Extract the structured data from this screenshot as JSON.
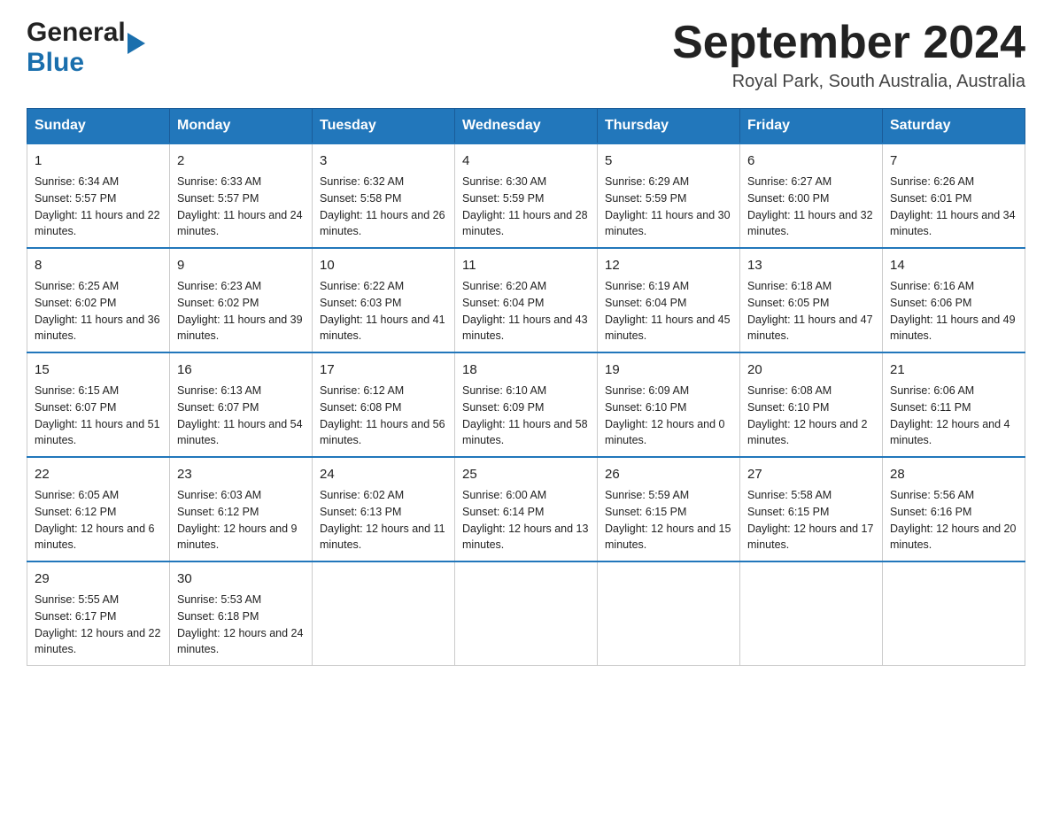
{
  "logo": {
    "general": "General",
    "triangle": "▶",
    "blue": "Blue"
  },
  "title": "September 2024",
  "subtitle": "Royal Park, South Australia, Australia",
  "days_header": [
    "Sunday",
    "Monday",
    "Tuesday",
    "Wednesday",
    "Thursday",
    "Friday",
    "Saturday"
  ],
  "weeks": [
    [
      {
        "day": "1",
        "sunrise": "6:34 AM",
        "sunset": "5:57 PM",
        "daylight": "11 hours and 22 minutes."
      },
      {
        "day": "2",
        "sunrise": "6:33 AM",
        "sunset": "5:57 PM",
        "daylight": "11 hours and 24 minutes."
      },
      {
        "day": "3",
        "sunrise": "6:32 AM",
        "sunset": "5:58 PM",
        "daylight": "11 hours and 26 minutes."
      },
      {
        "day": "4",
        "sunrise": "6:30 AM",
        "sunset": "5:59 PM",
        "daylight": "11 hours and 28 minutes."
      },
      {
        "day": "5",
        "sunrise": "6:29 AM",
        "sunset": "5:59 PM",
        "daylight": "11 hours and 30 minutes."
      },
      {
        "day": "6",
        "sunrise": "6:27 AM",
        "sunset": "6:00 PM",
        "daylight": "11 hours and 32 minutes."
      },
      {
        "day": "7",
        "sunrise": "6:26 AM",
        "sunset": "6:01 PM",
        "daylight": "11 hours and 34 minutes."
      }
    ],
    [
      {
        "day": "8",
        "sunrise": "6:25 AM",
        "sunset": "6:02 PM",
        "daylight": "11 hours and 36 minutes."
      },
      {
        "day": "9",
        "sunrise": "6:23 AM",
        "sunset": "6:02 PM",
        "daylight": "11 hours and 39 minutes."
      },
      {
        "day": "10",
        "sunrise": "6:22 AM",
        "sunset": "6:03 PM",
        "daylight": "11 hours and 41 minutes."
      },
      {
        "day": "11",
        "sunrise": "6:20 AM",
        "sunset": "6:04 PM",
        "daylight": "11 hours and 43 minutes."
      },
      {
        "day": "12",
        "sunrise": "6:19 AM",
        "sunset": "6:04 PM",
        "daylight": "11 hours and 45 minutes."
      },
      {
        "day": "13",
        "sunrise": "6:18 AM",
        "sunset": "6:05 PM",
        "daylight": "11 hours and 47 minutes."
      },
      {
        "day": "14",
        "sunrise": "6:16 AM",
        "sunset": "6:06 PM",
        "daylight": "11 hours and 49 minutes."
      }
    ],
    [
      {
        "day": "15",
        "sunrise": "6:15 AM",
        "sunset": "6:07 PM",
        "daylight": "11 hours and 51 minutes."
      },
      {
        "day": "16",
        "sunrise": "6:13 AM",
        "sunset": "6:07 PM",
        "daylight": "11 hours and 54 minutes."
      },
      {
        "day": "17",
        "sunrise": "6:12 AM",
        "sunset": "6:08 PM",
        "daylight": "11 hours and 56 minutes."
      },
      {
        "day": "18",
        "sunrise": "6:10 AM",
        "sunset": "6:09 PM",
        "daylight": "11 hours and 58 minutes."
      },
      {
        "day": "19",
        "sunrise": "6:09 AM",
        "sunset": "6:10 PM",
        "daylight": "12 hours and 0 minutes."
      },
      {
        "day": "20",
        "sunrise": "6:08 AM",
        "sunset": "6:10 PM",
        "daylight": "12 hours and 2 minutes."
      },
      {
        "day": "21",
        "sunrise": "6:06 AM",
        "sunset": "6:11 PM",
        "daylight": "12 hours and 4 minutes."
      }
    ],
    [
      {
        "day": "22",
        "sunrise": "6:05 AM",
        "sunset": "6:12 PM",
        "daylight": "12 hours and 6 minutes."
      },
      {
        "day": "23",
        "sunrise": "6:03 AM",
        "sunset": "6:12 PM",
        "daylight": "12 hours and 9 minutes."
      },
      {
        "day": "24",
        "sunrise": "6:02 AM",
        "sunset": "6:13 PM",
        "daylight": "12 hours and 11 minutes."
      },
      {
        "day": "25",
        "sunrise": "6:00 AM",
        "sunset": "6:14 PM",
        "daylight": "12 hours and 13 minutes."
      },
      {
        "day": "26",
        "sunrise": "5:59 AM",
        "sunset": "6:15 PM",
        "daylight": "12 hours and 15 minutes."
      },
      {
        "day": "27",
        "sunrise": "5:58 AM",
        "sunset": "6:15 PM",
        "daylight": "12 hours and 17 minutes."
      },
      {
        "day": "28",
        "sunrise": "5:56 AM",
        "sunset": "6:16 PM",
        "daylight": "12 hours and 20 minutes."
      }
    ],
    [
      {
        "day": "29",
        "sunrise": "5:55 AM",
        "sunset": "6:17 PM",
        "daylight": "12 hours and 22 minutes."
      },
      {
        "day": "30",
        "sunrise": "5:53 AM",
        "sunset": "6:18 PM",
        "daylight": "12 hours and 24 minutes."
      },
      null,
      null,
      null,
      null,
      null
    ]
  ]
}
